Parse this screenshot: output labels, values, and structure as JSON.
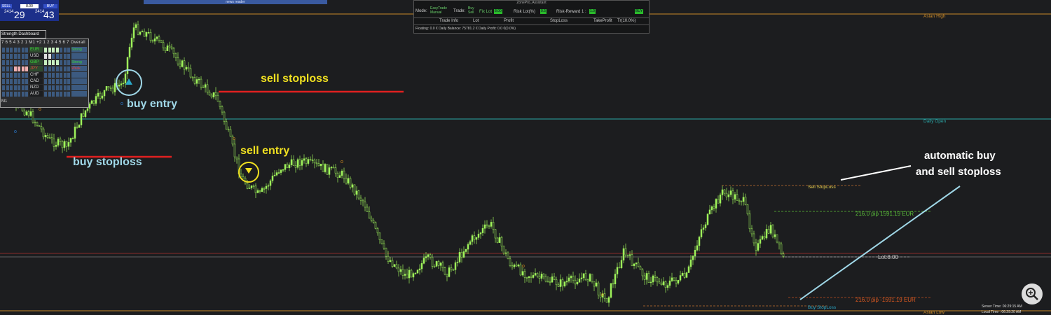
{
  "trade_panel": {
    "sell_label": "SELL",
    "lot_value": "8.00",
    "buy_label": "BUY",
    "bid_prefix": "2414.",
    "bid_big": "29",
    "ask_prefix": "2414.",
    "ask_big": "43"
  },
  "news_header": "news reader",
  "strength_dashboard": {
    "title": "Strength Dashboard",
    "header": "7 6 5 4 3 2 1   M1 +2 1 2 3 4 5 6 7 Overall",
    "timeframe": "M1",
    "rows": [
      {
        "currency": "EUR",
        "overall": "Strong",
        "color": "#3ad13a"
      },
      {
        "currency": "USD",
        "overall": "",
        "color": "#dddddd"
      },
      {
        "currency": "GBP",
        "overall": "Strong",
        "color": "#3ad13a"
      },
      {
        "currency": "JPY",
        "overall": "Weak",
        "color": "#e04040"
      },
      {
        "currency": "CHF",
        "overall": "",
        "color": "#dddddd"
      },
      {
        "currency": "CAD",
        "overall": "",
        "color": "#dddddd"
      },
      {
        "currency": "NZD",
        "overall": "",
        "color": "#dddddd"
      },
      {
        "currency": "AUD",
        "overall": "",
        "color": "#dddddd"
      }
    ]
  },
  "assistant": {
    "title": "ZonePro_Assistant",
    "mode_label": "Mode:",
    "mode_value": "EasyTrade\nManual",
    "trade_label": "Trade:",
    "trade_value": "Buy\nSell",
    "fix_lot_label": "Fix Lot",
    "fix_lot_value": "8.00",
    "risk_lot_label": "Risk Lot(%)",
    "risk_lot_value": "0.5",
    "rr_label": "Risk-Reward 1 :",
    "rr_value": "1.0",
    "buy_button": "BUY",
    "columns": [
      "Trade Info",
      "Lot",
      "Profit",
      "StopLoss",
      "TakeProfit",
      "Tr(10.0%)"
    ],
    "footer": "Floating: 0.0 €  Daily Balance: 75781.2 €   Daily Profit: 0.0 €(0.0%)"
  },
  "levels": {
    "asian_high": "Asian High",
    "daily_open": "Daily Open",
    "asian_low": "Asian Low",
    "sell_stoploss": "Sell StopLoss",
    "buy_stoploss": "Buy StopLoss",
    "tp_label": "216.0 pip 1591.19 EUR",
    "sl_label": "216.0 pip -1591.19 EUR",
    "lot_label": "Lot:8.00"
  },
  "annotations": {
    "buy_entry": "buy entry",
    "buy_stoploss": "buy stoploss",
    "sell_stoploss": "sell stoploss",
    "sell_entry": "sell entry",
    "auto_line1": "automatic buy",
    "auto_line2": "and sell stoploss"
  },
  "server": {
    "server_time": "Server Time:  06:29:15 AM",
    "local_time": "Local Time :  06:29:20 AM"
  },
  "colors": {
    "background": "#1c1d1f",
    "candle": "#9ef25a",
    "asian_line": "#c8892a",
    "daily_open": "#2aa6a6",
    "annotation_yellow": "#f0e020",
    "annotation_cyan": "#a0d8e8",
    "stoploss_red": "#e02020"
  }
}
